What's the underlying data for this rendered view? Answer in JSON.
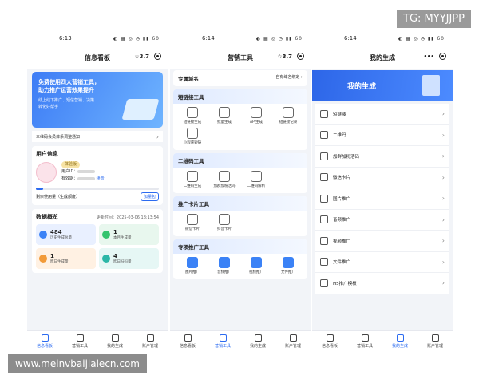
{
  "overlay": {
    "tg": "TG: MYYJJPP",
    "site": "www.meinvbaijialecn.com"
  },
  "screens": [
    {
      "time": "6:13",
      "status_icons": "◐ ▦ ◎ ◔ ▮▮ 60",
      "title": "信息看板",
      "rating": "☆3.7",
      "banner": {
        "line1": "免费使用四大营销工具，",
        "line2": "助力推广运营效果提升",
        "sub1": "线上线下推广、短信营销、决策",
        "sub2": "转化好帮手"
      },
      "notice": "三维码会员体系调整通知",
      "user_title": "用户信息",
      "badge": "体验版",
      "uid_label": "用户ID：",
      "expire_label": "有效期：",
      "renew": "续费",
      "usage_label": "剩余使用量（生成额度）",
      "usage_btn": "加量包",
      "usage_fraction": 0.06,
      "overview_title": "数据概览",
      "updated": "更新时间：2025-03-06 18:13:54",
      "stats": [
        {
          "value": "484",
          "label": "历史生成总量",
          "bg": "#e9f0ff",
          "dot": "#3b82f6"
        },
        {
          "value": "1",
          "label": "本月生成量",
          "bg": "#e8f7ee",
          "dot": "#34c46e"
        },
        {
          "value": "1",
          "label": "昨日生成量",
          "bg": "#fff1e3",
          "dot": "#f29a38"
        },
        {
          "value": "4",
          "label": "昨日扫码量",
          "bg": "#e6f7f5",
          "dot": "#2bb7a7"
        }
      ]
    },
    {
      "time": "6:14",
      "status_icons": "◐ ▦ ◎ ◔ ▮▮ 60",
      "title": "营销工具",
      "rating": "☆3.7",
      "domain": "专属域名",
      "domain_action": "自有域名绑定 ›",
      "sections": [
        {
          "title": "短链接工具",
          "tools": [
            "短链接生成",
            "批量生成",
            "API生成",
            "短链接记录",
            "小程序短链"
          ]
        },
        {
          "title": "二维码工具",
          "tools": [
            "二维码生成",
            "加群加粉活码",
            "二维码解析"
          ]
        },
        {
          "title": "推广卡片工具",
          "tools": [
            "微信卡片",
            "抖音卡片"
          ]
        },
        {
          "title": "专项推广工具",
          "tools": [
            "图片推广",
            "音频推广",
            "视频推广",
            "文件推广"
          ]
        }
      ]
    },
    {
      "time": "6:14",
      "status_icons": "◐ ▦ ◎ ◔ ▮▮ 60",
      "title": "我的生成",
      "more": "•••",
      "banner": "我的生成",
      "items": [
        "短链接",
        "二维码",
        "加群加粉活码",
        "微信卡片",
        "图片推广",
        "音频推广",
        "视频推广",
        "文件推广",
        "H5推广模板"
      ]
    }
  ],
  "tabs": [
    "信息看板",
    "营销工具",
    "我的生成",
    "账户管理"
  ],
  "active_tabs": [
    0,
    1,
    2
  ]
}
